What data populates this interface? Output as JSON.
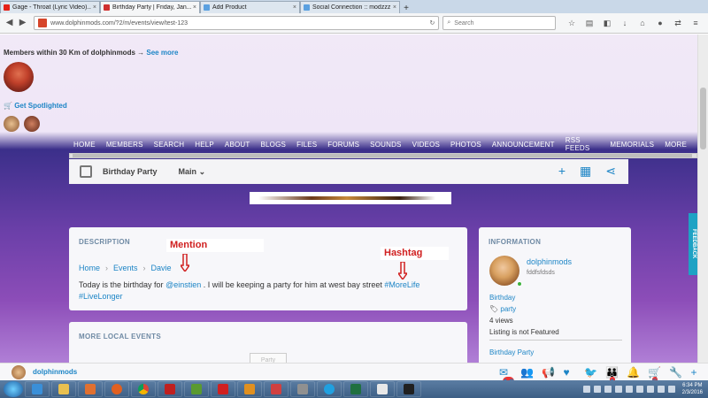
{
  "browser": {
    "tabs": [
      {
        "label": "Gage - Throat (Lyric Video)...",
        "color": "#e62117",
        "active": false
      },
      {
        "label": "Birthday Party | Friday, Jan...",
        "color": "#d03030",
        "active": true
      },
      {
        "label": "Add Product",
        "color": "#5aa0e0",
        "active": false
      },
      {
        "label": "Social Connection :: modzzz",
        "color": "#5aa0e0",
        "active": false
      }
    ],
    "new_tab": "+",
    "url": "www.dolphinmods.com/?2/m/events/view/test-123",
    "search_placeholder": "Search"
  },
  "sidebar_top": {
    "members_label": "Members within 30 Km of dolphinmods",
    "arrow": "→",
    "see_more": "See more",
    "spotlight": "Get Spotlighted"
  },
  "menu": [
    "HOME",
    "MEMBERS",
    "SEARCH",
    "HELP",
    "ABOUT",
    "BLOGS",
    "FILES",
    "FORUMS",
    "SOUNDS",
    "VIDEOS",
    "PHOTOS",
    "ANNOUNCEMENT",
    "RSS FEEDS",
    "MEMORIALS",
    "MORE"
  ],
  "event_bar": {
    "title": "Birthday Party",
    "main": "Main"
  },
  "description": {
    "header": "DESCRIPTION",
    "breadcrumb": [
      "Home",
      "Events",
      "Davie"
    ],
    "text_pre": "Today is the birthday for ",
    "mention": "@einstien",
    "text_mid": " . I will be keeping a party for him at west bay street ",
    "hashtag1": "#MoreLife",
    "hashtag2": "#LiveLonger"
  },
  "annotations": {
    "mention": "Mention",
    "hashtag": "Hashtag",
    "color": "#d02020"
  },
  "local_events": {
    "header": "MORE LOCAL EVENTS",
    "button": "Party"
  },
  "info": {
    "header": "INFORMATION",
    "user": "dolphinmods",
    "user_sub": "fddfsfdsds",
    "category": "Birthday",
    "tag": "party",
    "views": "4 views",
    "featured": "Listing is not Featured",
    "event_link": "Birthday Party"
  },
  "feedback": "FEEDBACK",
  "bottom": {
    "username": "dolphinmods",
    "icons": [
      {
        "name": "mail-icon",
        "glyph": "✉",
        "badge": "16"
      },
      {
        "name": "friends-icon",
        "glyph": "👥",
        "badge": ""
      },
      {
        "name": "megaphone-icon",
        "glyph": "📢",
        "badge": ""
      },
      {
        "name": "heart-icon",
        "glyph": "♥",
        "badge": ""
      },
      {
        "name": "twitter-icon",
        "glyph": "🐦",
        "badge": ""
      },
      {
        "name": "group-icon",
        "glyph": "👪",
        "badge": "1"
      },
      {
        "name": "bell-icon",
        "glyph": "🔔",
        "badge": ""
      },
      {
        "name": "cart-icon",
        "glyph": "🛒",
        "badge": "5"
      },
      {
        "name": "wrench-icon",
        "glyph": "🔧",
        "badge": ""
      },
      {
        "name": "plus-icon",
        "glyph": "+",
        "badge": ""
      }
    ]
  },
  "taskbar": {
    "time": "6:34 PM",
    "date": "2/3/2016"
  },
  "colors": {
    "link": "#1d85c6",
    "accent": "#d02020"
  }
}
